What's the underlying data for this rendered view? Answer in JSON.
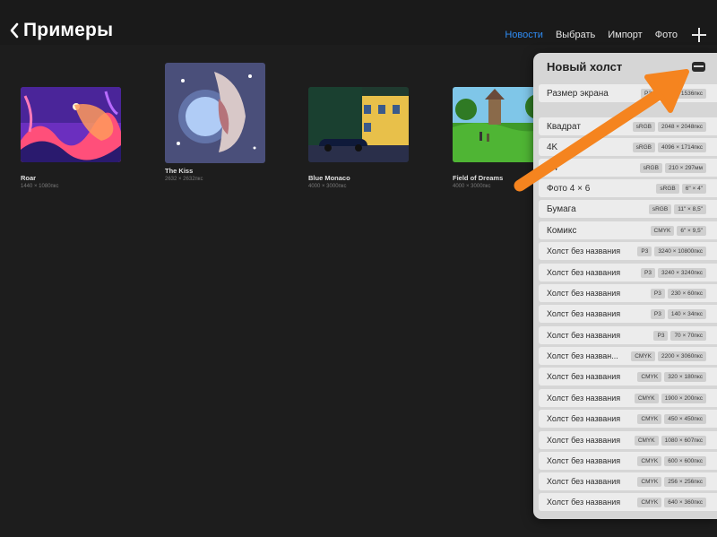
{
  "header": {
    "title": "Примеры",
    "tabs": [
      {
        "label": "Новости",
        "active": true
      },
      {
        "label": "Выбрать",
        "active": false
      },
      {
        "label": "Импорт",
        "active": false
      },
      {
        "label": "Фото",
        "active": false
      }
    ]
  },
  "gallery": [
    {
      "name": "Roar",
      "dims": "1440 × 1080пкс"
    },
    {
      "name": "The Kiss",
      "dims": "2632 × 2632пкс"
    },
    {
      "name": "Blue Monaco",
      "dims": "4000 × 3000пкс"
    },
    {
      "name": "Field of Dreams",
      "dims": "4000 × 3000пкс"
    }
  ],
  "popover": {
    "title": "Новый холст",
    "rows": [
      {
        "name": "Размер экрана",
        "space": "P3",
        "size": "2048 × 1536пкс"
      },
      {
        "name": "Квадрат",
        "space": "sRGB",
        "size": "2048 × 2048пкс"
      },
      {
        "name": "4K",
        "space": "sRGB",
        "size": "4096 × 1714пкс"
      },
      {
        "name": "A4",
        "space": "sRGB",
        "size": "210 × 297мм"
      },
      {
        "name": "Фото 4 × 6",
        "space": "sRGB",
        "size": "6\" × 4\""
      },
      {
        "name": "Бумага",
        "space": "sRGB",
        "size": "11\" × 8,5\""
      },
      {
        "name": "Комикс",
        "space": "CMYK",
        "size": "6\" × 9,5\""
      },
      {
        "name": "Холст без названия",
        "space": "P3",
        "size": "3240 × 10800пкс"
      },
      {
        "name": "Холст без названия",
        "space": "P3",
        "size": "3240 × 3240пкс"
      },
      {
        "name": "Холст без названия",
        "space": "P3",
        "size": "230 × 60пкс"
      },
      {
        "name": "Холст без названия",
        "space": "P3",
        "size": "140 × 34пкс"
      },
      {
        "name": "Холст без названия",
        "space": "P3",
        "size": "70 × 70пкс"
      },
      {
        "name": "Холст без назван...",
        "space": "CMYK",
        "size": "2200 × 3060пкс"
      },
      {
        "name": "Холст без названия",
        "space": "CMYK",
        "size": "320 × 180пкс"
      },
      {
        "name": "Холст без названия",
        "space": "CMYK",
        "size": "1900 × 200пкс"
      },
      {
        "name": "Холст без названия",
        "space": "CMYK",
        "size": "450 × 450пкс"
      },
      {
        "name": "Холст без названия",
        "space": "CMYK",
        "size": "1080 × 607пкс"
      },
      {
        "name": "Холст без названия",
        "space": "CMYK",
        "size": "600 × 600пкс"
      },
      {
        "name": "Холст без названия",
        "space": "CMYK",
        "size": "256 × 256пкс"
      },
      {
        "name": "Холст без названия",
        "space": "CMYK",
        "size": "640 × 360пкс"
      }
    ]
  },
  "colors": {
    "accent": "#2f8cf4",
    "arrow": "#f5841f",
    "background": "#1d1d1d",
    "popover": "#d6d6d6"
  },
  "icons": {
    "back": "chevron-left-icon",
    "add": "plus-icon",
    "folder": "folder-icon"
  }
}
